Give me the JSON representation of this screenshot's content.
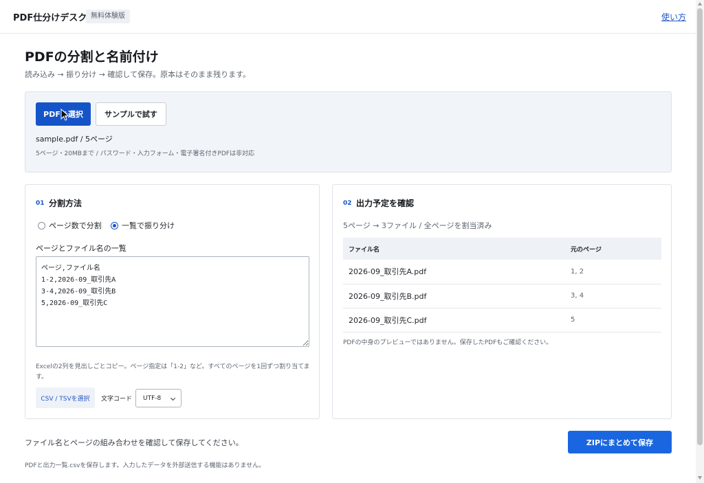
{
  "header": {
    "brand": "PDF仕分けデスク",
    "badge": "無料体験版",
    "help_link": "使い方"
  },
  "page": {
    "title": "PDFの分割と名前付け",
    "subtitle": "読み込み → 振り分け → 確認して保存。原本はそのまま残ります。"
  },
  "upload": {
    "select_button": "PDFを選択",
    "sample_button": "サンプルで試す",
    "file_info": "sample.pdf / 5ページ",
    "limit_note": "5ページ・20MBまで / パスワード・入力フォーム・電子署名付きPDFは非対応"
  },
  "split": {
    "step": "01",
    "heading": "分割方法",
    "options": [
      {
        "label": "ページ数で分割",
        "selected": false
      },
      {
        "label": "一覧で振り分け",
        "selected": true
      }
    ],
    "list_label": "ページとファイル名の一覧",
    "mapping_text": "ページ,ファイル名\n1-2,2026-09_取引先A\n3-4,2026-09_取引先B\n5,2026-09_取引先C",
    "hint": "Excelの2列を見出しごとコピー。ページ指定は「1-2」など。すべてのページを1回ずつ割り当てます。",
    "csv_button": "CSV / TSVを選択",
    "encoding_label": "文字コード",
    "encoding_value": "UTF-8"
  },
  "output": {
    "step": "02",
    "heading": "出力予定を確認",
    "summary": "5ページ → 3ファイル / 全ページを割当済み",
    "columns": [
      "ファイル名",
      "元のページ"
    ],
    "rows": [
      {
        "name": "2026-09_取引先A.pdf",
        "pages": "1, 2"
      },
      {
        "name": "2026-09_取引先B.pdf",
        "pages": "3, 4"
      },
      {
        "name": "2026-09_取引先C.pdf",
        "pages": "5"
      }
    ],
    "preview_note": "PDFの中身のプレビューではありません。保存したPDFもご確認ください。"
  },
  "footer": {
    "message": "ファイル名とページの組み合わせを確認して保存してください。",
    "note": "PDFと出力一覧.csvを保存します。入力したデータを外部送信する機能はありません。",
    "zip_button": "ZIPにまとめて保存"
  },
  "colors": {
    "primary": "#1554c8",
    "zip_button": "#1a66e0",
    "panel_bg": "#f1f4f8"
  }
}
